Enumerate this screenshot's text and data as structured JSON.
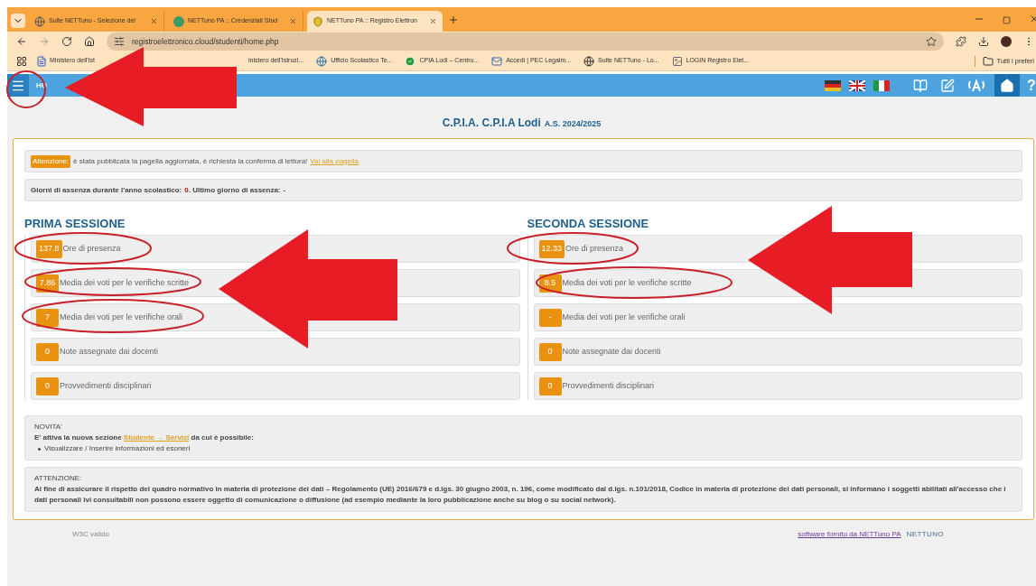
{
  "browser": {
    "tabs": [
      {
        "title": "Suite NETTuno - Selezione del",
        "selected": false
      },
      {
        "title": "NETTuno PA :: Credenziali Stud",
        "selected": false
      },
      {
        "title": "NETTuno PA :: Registro Elettron",
        "selected": true
      }
    ],
    "address": "registroelettronico.cloud/studenti/home.php",
    "bookmarks": [
      {
        "label": "Ministero dell'Ist"
      },
      {
        "label": "inistero dell'Istruzi..."
      },
      {
        "label": "Ufficio Scolastico Te..."
      },
      {
        "label": "CPIA Lodi – Centro..."
      },
      {
        "label": "Accedi | PEC Legalm..."
      },
      {
        "label": "Suite NETTuno - Lo..."
      },
      {
        "label": "LOGIN Registro Elet..."
      }
    ],
    "all_bookmarks": "Tutti i preferi"
  },
  "app_header": {
    "title": "HO",
    "help": "?"
  },
  "school": {
    "name": "C.P.I.A. C.P.I.A Lodi",
    "year": "A.S. 2024/2025"
  },
  "alert": {
    "badge": "Attenzione:",
    "text": "è stata pubblicata la pagella aggiornata, è richiesta la conferma di lettura!",
    "link": "Vai alla pagella"
  },
  "absence": {
    "label": "Giorni di assenza durante l'anno scolastico:",
    "days": "0",
    "last_label": ". Ultimo giorno di assenza:",
    "last": "-"
  },
  "sessions": [
    {
      "title": "PRIMA SESSIONE",
      "rows": [
        {
          "value": "137.8",
          "label": "Ore di presenza"
        },
        {
          "value": "7.86",
          "label": "Media dei voti per le verifiche scritte"
        },
        {
          "value": "7",
          "label": "Media dei voti per le verifiche orali"
        },
        {
          "value": "0",
          "label": "Note assegnate dai docenti"
        },
        {
          "value": "0",
          "label": "Provvedimenti disciplinari"
        }
      ]
    },
    {
      "title": "SECONDA SESSIONE",
      "rows": [
        {
          "value": "12.33",
          "label": "Ore di presenza"
        },
        {
          "value": "8.5",
          "label": "Media dei voti per le verifiche scritte"
        },
        {
          "value": "-",
          "label": "Media dei voti per le verifiche orali"
        },
        {
          "value": "0",
          "label": "Note assegnate dai docenti"
        },
        {
          "value": "0",
          "label": "Provvedimenti disciplinari"
        }
      ]
    }
  ],
  "news": {
    "title": "NOVITA'",
    "before": "E' attiva la nuova sezione",
    "link": "Studente → Servizi",
    "after": "da cui è possibile:",
    "items": [
      "Visualizzare / Inserire informazioni ed esoneri"
    ]
  },
  "privacy": {
    "title": "ATTENZIONE:",
    "text": "Al fine di assicurare il rispetto del quadro normativo in materia di protezione dei dati – Regolamento (UE) 2016/679 e d.lgs. 30 giugno 2003, n. 196, come modificato dal d.lgs. n.101/2018, Codice in materia di protezione dei dati personali, si informano i soggetti abilitati all'accesso che i dati personali ivi consultabili non possono essere oggetto di comunicazione o diffusione (ad esempio mediante la loro pubblicazione anche su blog o su social network)."
  },
  "footer": {
    "validator": "W3C valido",
    "credit": "software fornito da NETTuno PA",
    "logo": "NETTUNO"
  }
}
